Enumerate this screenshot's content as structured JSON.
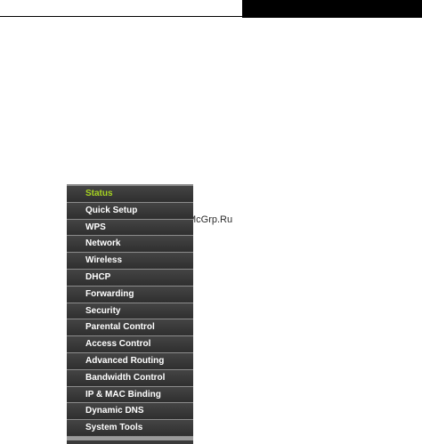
{
  "watermark": {
    "text": "McGrp.Ru"
  },
  "menu": {
    "active_color": "#a6d321",
    "text_color": "#ffffff",
    "background_color": "#333333",
    "items": [
      {
        "label": "Status",
        "active": true
      },
      {
        "label": "Quick Setup",
        "active": false
      },
      {
        "label": "WPS",
        "active": false
      },
      {
        "label": "Network",
        "active": false
      },
      {
        "label": "Wireless",
        "active": false
      },
      {
        "label": "DHCP",
        "active": false
      },
      {
        "label": "Forwarding",
        "active": false
      },
      {
        "label": "Security",
        "active": false
      },
      {
        "label": "Parental Control",
        "active": false
      },
      {
        "label": "Access Control",
        "active": false
      },
      {
        "label": "Advanced Routing",
        "active": false
      },
      {
        "label": "Bandwidth Control",
        "active": false
      },
      {
        "label": "IP & MAC Binding",
        "active": false
      },
      {
        "label": "Dynamic DNS",
        "active": false
      },
      {
        "label": "System Tools",
        "active": false
      }
    ]
  }
}
